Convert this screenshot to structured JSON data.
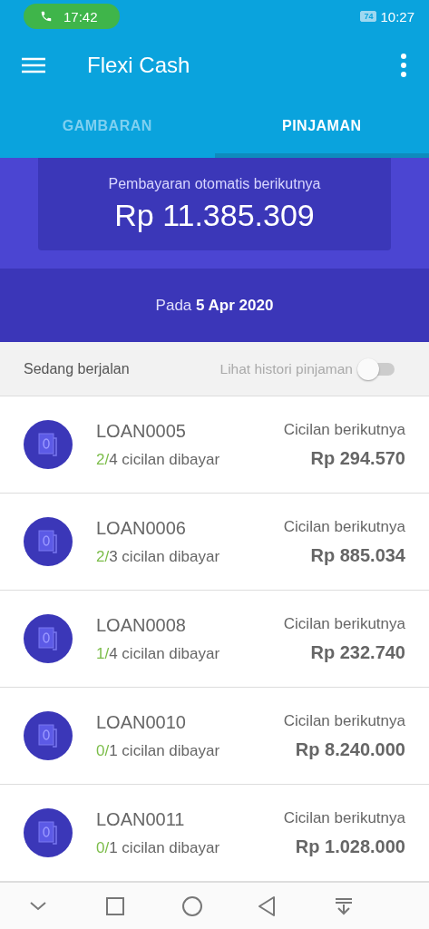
{
  "status_bar": {
    "call_time": "17:42",
    "battery": "74",
    "time": "10:27"
  },
  "app_bar": {
    "title": "Flexi Cash"
  },
  "tabs": [
    {
      "label": "GAMBARAN",
      "selected": false
    },
    {
      "label": "PINJAMAN",
      "selected": true
    }
  ],
  "summary": {
    "caption": "Pembayaran otomatis berikutnya",
    "amount": "Rp 11.385.309",
    "date": "Pada **5 Apr 2020**"
  },
  "filter": {
    "label": "Sedang berjalan",
    "toggle_label": "Lihat histori pinjaman",
    "on": false
  },
  "loans": [
    {
      "id": "LOAN0005",
      "paid": "2/",
      "progress": "4 cicilan dibayar",
      "next_label": "Cicilan berikutnya",
      "amount": "Rp 294.570"
    },
    {
      "id": "LOAN0006",
      "paid": "2/",
      "progress": "3 cicilan dibayar",
      "next_label": "Cicilan berikutnya",
      "amount": "Rp 885.034"
    },
    {
      "id": "LOAN0008",
      "paid": "1/",
      "progress": "4 cicilan dibayar",
      "next_label": "Cicilan berikutnya",
      "amount": "Rp 232.740"
    },
    {
      "id": "LOAN0010",
      "paid": "0/",
      "progress": "1 cicilan dibayar",
      "next_label": "Cicilan berikutnya",
      "amount": "Rp 8.240.000"
    },
    {
      "id": "LOAN0011",
      "paid": "0/",
      "progress": "1 cicilan dibayar",
      "next_label": "Cicilan berikutnya",
      "amount": "Rp 1.028.000"
    }
  ]
}
